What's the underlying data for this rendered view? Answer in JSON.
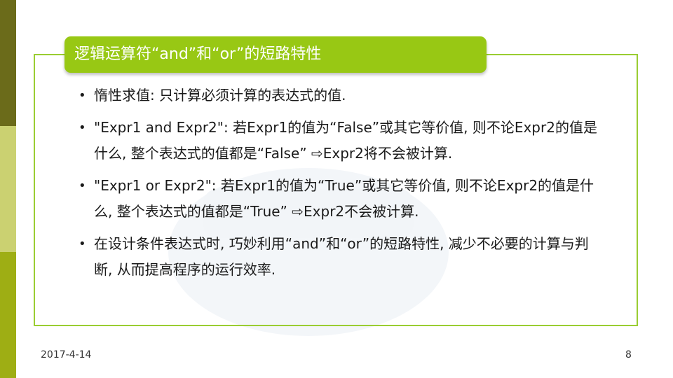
{
  "slide": {
    "title": "逻辑运算符“and”和“or”的短路特性",
    "bullets": [
      "惰性求值: 只计算必须计算的表达式的值.",
      "\"Expr1 and Expr2\": 若Expr1的值为“False”或其它等价值, 则不论Expr2的值是什么, 整个表达式的值都是“False” ⇨Expr2将不会被计算.",
      "\"Expr1 or Expr2\": 若Expr1的值为“True”或其它等价值, 则不论Expr2的值是什么, 整个表达式的值都是“True” ⇨Expr2不会被计算.",
      "在设计条件表达式时, 巧妙利用“and”和“or”的短路特性, 减少不必要的计算与判断, 从而提高程序的运行效率."
    ],
    "bullet_symbol": "•"
  },
  "footer": {
    "date": "2017-4-14",
    "page": "8"
  },
  "colors": {
    "accent_green": "#98c814",
    "border_green": "#9acd32",
    "side_dark": "#6b6b1a",
    "side_light": "#cbd171",
    "side_mid": "#9eae14"
  }
}
